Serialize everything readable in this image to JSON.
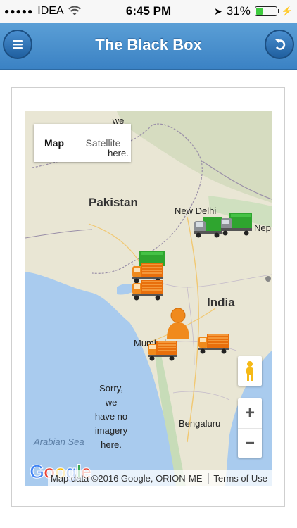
{
  "status": {
    "carrier": "IDEA",
    "time": "6:45 PM",
    "battery": "31%"
  },
  "header": {
    "title": "The Black Box"
  },
  "map": {
    "type_control": {
      "map": "Map",
      "satellite": "Satellite"
    },
    "labels": {
      "pakistan": "Pakistan",
      "india": "India",
      "new_delhi": "New Delhi",
      "nepal": "Nep",
      "mumbai": "Mumbai",
      "bengaluru": "Bengaluru",
      "arabian_sea": "Arabian Sea"
    },
    "no_imagery_top": [
      "we",
      "here."
    ],
    "no_imagery": [
      "Sorry,",
      "we",
      "have no",
      "imagery",
      "here."
    ],
    "zoom_in": "+",
    "zoom_out": "−",
    "attribution": "Map data ©2016 Google, ORION-ME",
    "terms": "Terms of Use",
    "logo": "Google",
    "markers": [
      {
        "kind": "truck",
        "status": "gray",
        "label": "truck-near-new-delhi"
      },
      {
        "kind": "truck",
        "status": "green",
        "label": "truck-near-new-delhi-2"
      },
      {
        "kind": "truck",
        "status": "green",
        "label": "truck-gujarat"
      },
      {
        "kind": "truck",
        "status": "orange",
        "label": "truck-gujarat-2"
      },
      {
        "kind": "truck",
        "status": "orange",
        "label": "truck-gujarat-3"
      },
      {
        "kind": "person",
        "status": "orange",
        "label": "person-maharashtra"
      },
      {
        "kind": "truck",
        "status": "orange",
        "label": "truck-mumbai"
      },
      {
        "kind": "truck",
        "status": "orange",
        "label": "truck-maharashtra"
      }
    ]
  },
  "colors": {
    "header": "#3b82c4",
    "water": "#a9cbee",
    "land": "#e9e6d4",
    "truck_orange": "#f08a1c",
    "truck_green": "#2fa52f"
  }
}
